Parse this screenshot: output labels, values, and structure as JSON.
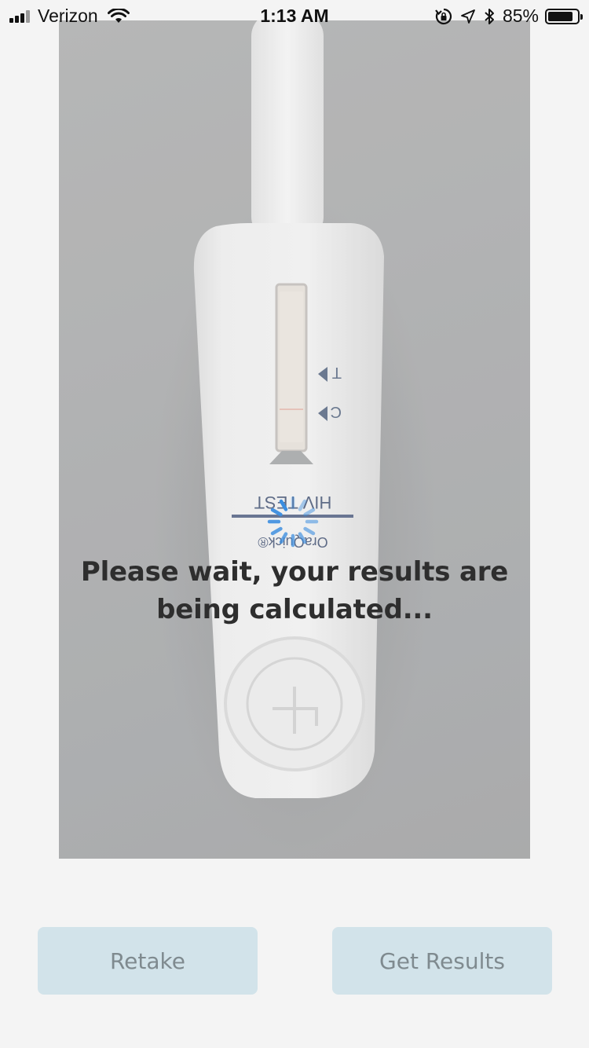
{
  "status_bar": {
    "carrier": "Verizon",
    "time": "1:13 AM",
    "battery_percent_text": "85%",
    "battery_level": 0.85,
    "signal_bars": 3
  },
  "photo": {
    "strip_labels": {
      "t": "T",
      "c": "C",
      "product_text": "HIV TEST",
      "brand": "OraQuick®"
    }
  },
  "overlay": {
    "message": "Please wait, your results are being calculated..."
  },
  "buttons": {
    "retake_label": "Retake",
    "get_results_label": "Get Results"
  },
  "colors": {
    "button_bg": "#d2e3ea",
    "button_text": "#7f8a8f",
    "spinner": "#3a8de0",
    "message_text": "#2e2e2e"
  }
}
